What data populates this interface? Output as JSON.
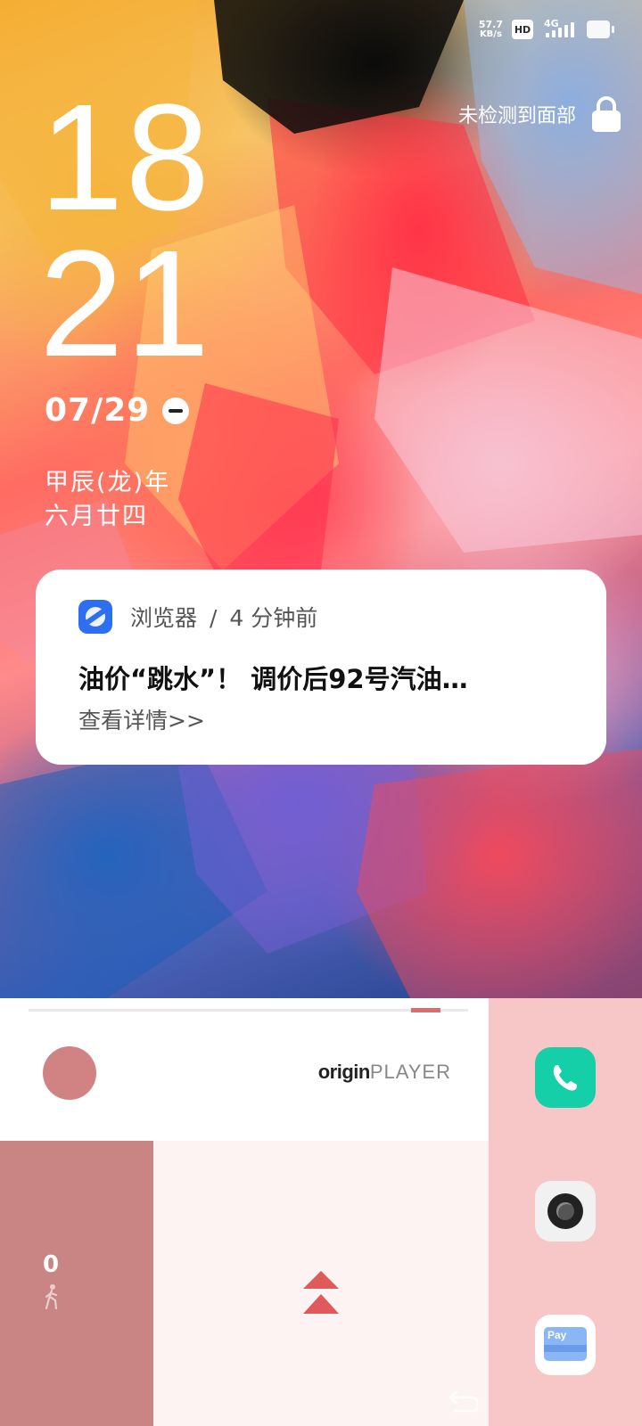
{
  "status_bar": {
    "net_speed": "57.7",
    "net_unit": "KB/s",
    "hd_badge": "HD",
    "network_type": "4G",
    "signal_icon": "signal-bars-icon",
    "battery_icon": "battery-icon"
  },
  "clock": {
    "hours": "18",
    "minutes": "21"
  },
  "date": {
    "text": "07/29",
    "dnd_icon": "do-not-disturb-icon"
  },
  "lunar": {
    "year": "甲辰(龙)年",
    "day": "六月廿四"
  },
  "face_unlock": {
    "text": "未检测到面部",
    "icon": "lock-icon"
  },
  "notification": {
    "app_name": "浏览器",
    "separator": "/",
    "time": "4 分钟前",
    "title": "油价“跳水”！ 调价后92号汽油…",
    "action": "查看详情>>",
    "app_icon": "browser-icon"
  },
  "music_widget": {
    "logo_bold": "origin",
    "logo_light": "PLAYER",
    "progress_fraction": 0.9,
    "accent_color": "#e06b6b"
  },
  "steps_widget": {
    "count": "0",
    "icon": "walking-person-icon"
  },
  "swipe_area": {
    "icon": "double-chevron-up-icon",
    "back_icon": "back-arrow-icon"
  },
  "dock": {
    "phone_icon": "phone-icon",
    "camera_icon": "camera-icon",
    "pay_label": "Pay",
    "pay_icon": "wallet-pay-icon"
  },
  "colors": {
    "phone_bg": "#14cfa8",
    "dock_bg": "#f7c7c7",
    "steps_bg": "#c98584",
    "swipe_bg": "#fdf3f3"
  }
}
